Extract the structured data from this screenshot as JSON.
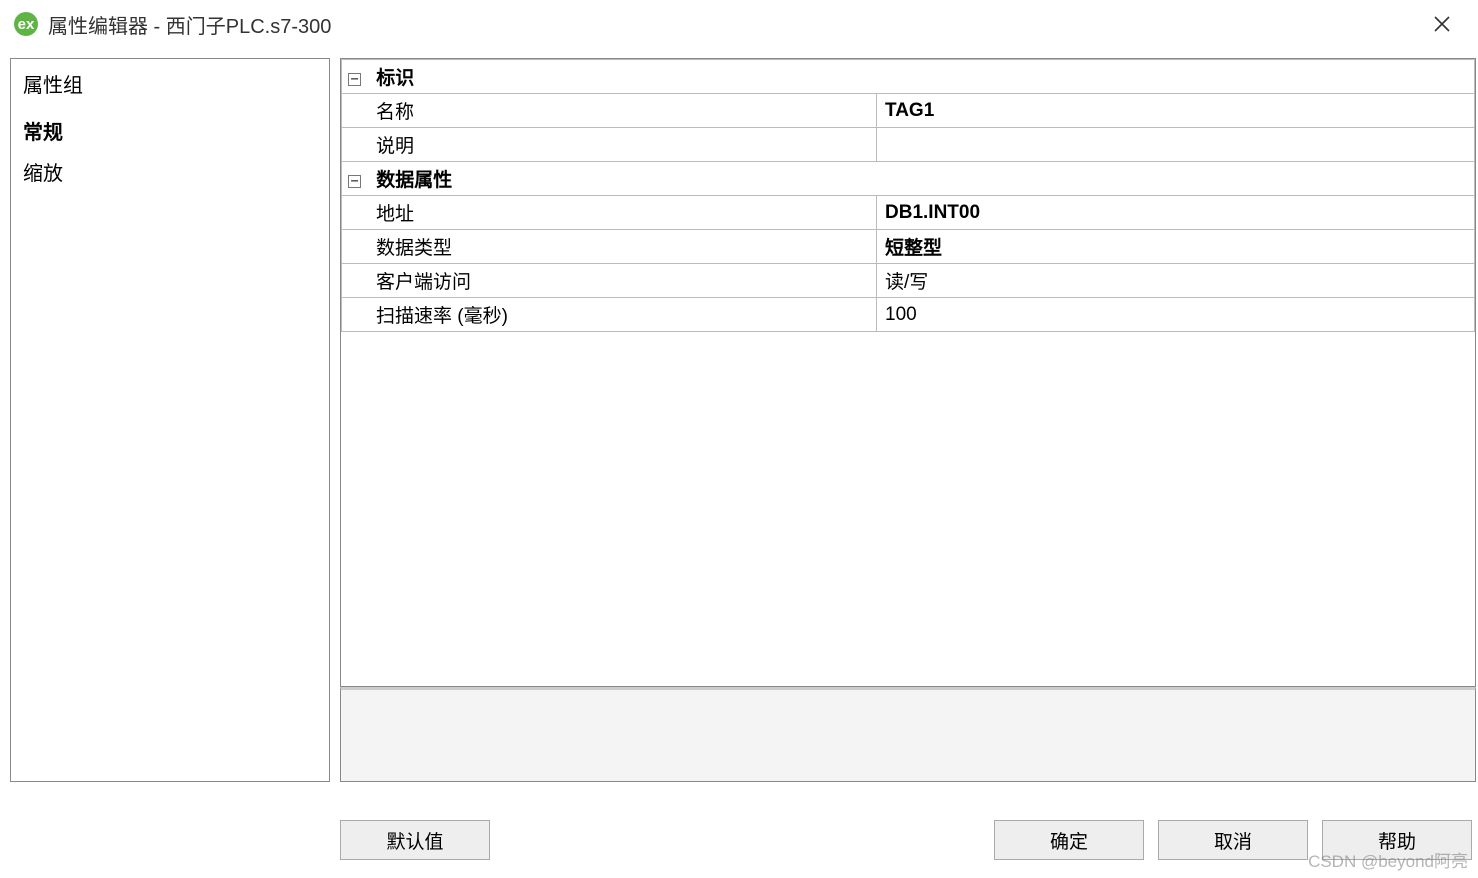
{
  "title": "属性编辑器 - 西门子PLC.s7-300",
  "app_icon_text": "ex",
  "sidebar": {
    "heading": "属性组",
    "items": [
      {
        "label": "常规",
        "active": true
      },
      {
        "label": "缩放",
        "active": false
      }
    ]
  },
  "properties": {
    "group1": {
      "label": "标识",
      "rows": [
        {
          "label": "名称",
          "value": "TAG1",
          "bold": false
        },
        {
          "label": "说明",
          "value": "",
          "bold": false
        }
      ]
    },
    "group2": {
      "label": "数据属性",
      "rows": [
        {
          "label": "地址",
          "value": "DB1.INT00",
          "bold": true
        },
        {
          "label": "数据类型",
          "value": "短整型",
          "bold": true
        },
        {
          "label": "客户端访问",
          "value": "读/写",
          "bold": false
        },
        {
          "label": "扫描速率 (毫秒)",
          "value": "100",
          "bold": false
        }
      ]
    }
  },
  "buttons": {
    "defaults": "默认值",
    "ok": "确定",
    "cancel": "取消",
    "help": "帮助"
  },
  "watermark": "CSDN @beyond阿亮"
}
